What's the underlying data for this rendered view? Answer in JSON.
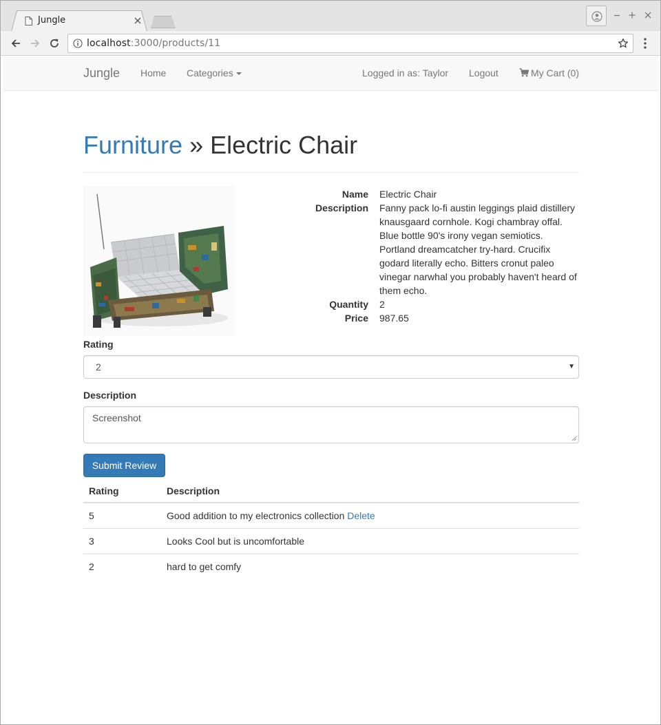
{
  "browser": {
    "tab_title": "Jungle",
    "url_host": "localhost",
    "url_path": ":3000/products/11"
  },
  "navbar": {
    "brand": "Jungle",
    "home": "Home",
    "categories": "Categories",
    "logged_in": "Logged in as: Taylor",
    "logout": "Logout",
    "cart": "My Cart (0)"
  },
  "header": {
    "category": "Furniture",
    "separator": " » ",
    "product": "Electric Chair"
  },
  "product": {
    "details": [
      {
        "label": "Name",
        "value": "Electric Chair"
      },
      {
        "label": "Description",
        "value": "Fanny pack lo-fi austin leggings plaid distillery knausgaard cornhole. Kogi chambray offal. Blue bottle 90's irony vegan semiotics. Portland dreamcatcher try-hard. Crucifix godard literally echo. Bitters cronut paleo vinegar narwhal you probably haven't heard of them echo."
      },
      {
        "label": "Quantity",
        "value": "2"
      },
      {
        "label": "Price",
        "value": "987.65"
      }
    ]
  },
  "review_form": {
    "rating_label": "Rating",
    "rating_value": "2",
    "description_label": "Description",
    "description_value": "Screenshot",
    "submit": "Submit Review"
  },
  "reviews": {
    "headers": [
      "Rating",
      "Description"
    ],
    "rows": [
      {
        "rating": "5",
        "description": "Good addition to my electronics collection",
        "action": "Delete"
      },
      {
        "rating": "3",
        "description": "Looks Cool but is uncomfortable",
        "action": ""
      },
      {
        "rating": "2",
        "description": "hard to get comfy",
        "action": ""
      }
    ]
  },
  "colors": {
    "link": "#337ab7",
    "button": "#337ab7",
    "navbar_bg": "#f8f8f8"
  }
}
